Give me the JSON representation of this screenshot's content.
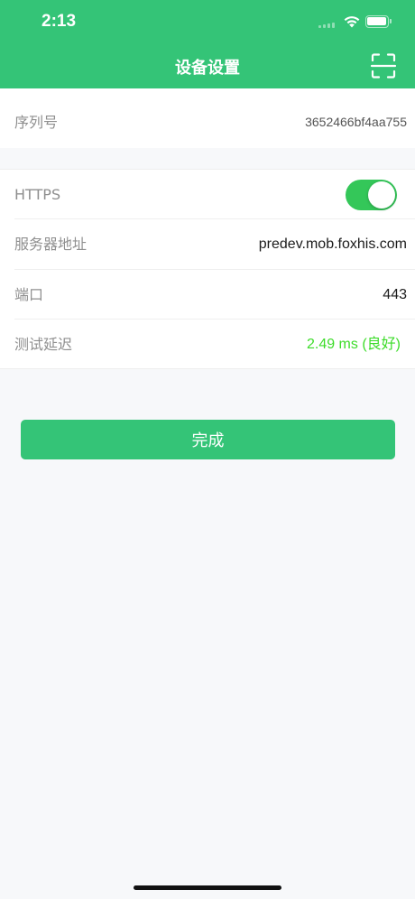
{
  "status_bar": {
    "time": "2:13",
    "icons": [
      "signal-icon",
      "wifi-icon",
      "battery-icon"
    ]
  },
  "header": {
    "title": "设备设置",
    "scan_icon": "scan-icon",
    "background": "#34C477"
  },
  "serial": {
    "label": "序列号",
    "value": "3652466bf4aa755"
  },
  "settings": {
    "https": {
      "label": "HTTPS",
      "enabled": true
    },
    "server": {
      "label": "服务器地址",
      "value": "predev.mob.foxhis.com"
    },
    "port": {
      "label": "端口",
      "value": "443"
    },
    "latency": {
      "label": "测试延迟",
      "value": "2.49 ms (良好)",
      "color": "#3DDC2A"
    }
  },
  "actions": {
    "done_label": "完成"
  },
  "colors": {
    "accent": "#34C477",
    "toggle_on": "#34C759"
  }
}
